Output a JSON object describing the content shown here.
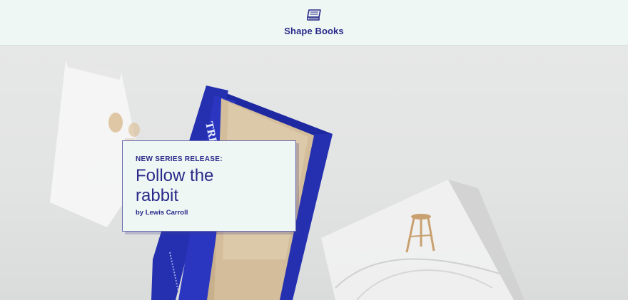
{
  "header": {
    "brand_name": "Shape Books",
    "brand_icon": "book-icon"
  },
  "hero": {
    "kicker": "NEW SERIES RELEASE:",
    "title": "Follow the rabbit",
    "author": "by Lewis Carroll",
    "book_spine_text": "TREAS"
  },
  "colors": {
    "brand": "#2a2a8a",
    "header_bg": "#eef7f4",
    "book_cover": "#2430b0",
    "page_edge": "#c9b08a"
  }
}
